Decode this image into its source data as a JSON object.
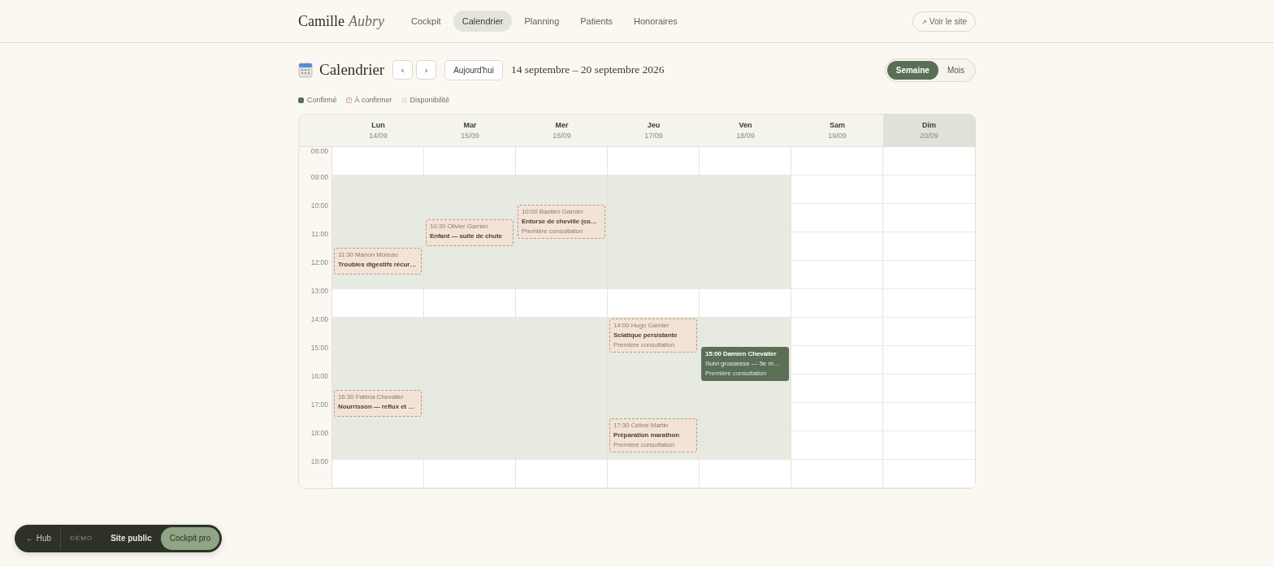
{
  "brand": {
    "first": "Camille",
    "last": "Aubry"
  },
  "nav": [
    {
      "label": "Cockpit",
      "selected": false
    },
    {
      "label": "Calendrier",
      "selected": true
    },
    {
      "label": "Planning",
      "selected": false
    },
    {
      "label": "Patients",
      "selected": false
    },
    {
      "label": "Honoraires",
      "selected": false
    }
  ],
  "site_link": {
    "icon": "↗",
    "label": "Voir le site"
  },
  "toolbar": {
    "title": "Calendrier",
    "prev": "‹",
    "next": "›",
    "today": "Aujourd'hui",
    "range": "14 septembre – 20 septembre 2026",
    "views": [
      {
        "label": "Semaine",
        "selected": true
      },
      {
        "label": "Mois",
        "selected": false
      }
    ]
  },
  "legend": [
    {
      "label": "Confirmé",
      "kind": "confirmed"
    },
    {
      "label": "À confirmer",
      "kind": "pending"
    },
    {
      "label": "Disponibilité",
      "kind": "available"
    }
  ],
  "hours": [
    "08:00",
    "09:00",
    "10:00",
    "11:00",
    "12:00",
    "13:00",
    "14:00",
    "15:00",
    "16:00",
    "17:00",
    "18:00",
    "19:00"
  ],
  "days": [
    {
      "name": "Lun",
      "date": "14/09",
      "selected": false,
      "slots": [
        {
          "available": false
        },
        {
          "available": true
        },
        {
          "available": true
        },
        {
          "available": true
        },
        {
          "available": true
        },
        {
          "available": false
        },
        {
          "available": true
        },
        {
          "available": true
        },
        {
          "available": true
        },
        {
          "available": true
        },
        {
          "available": true
        },
        {
          "available": false
        }
      ],
      "events": [
        {
          "time": "11:30",
          "name": "Manon Moreau",
          "title": "Troubles digestifs récur…",
          "kind": "pending"
        },
        {
          "time": "16:30",
          "name": "Fatima Chevalier",
          "title": "Nourrisson — reflux et …",
          "kind": "pending"
        }
      ]
    },
    {
      "name": "Mar",
      "date": "15/09",
      "selected": false,
      "slots": [
        {
          "available": false
        },
        {
          "available": true
        },
        {
          "available": true
        },
        {
          "available": true
        },
        {
          "available": true
        },
        {
          "available": false
        },
        {
          "available": true
        },
        {
          "available": true
        },
        {
          "available": true
        },
        {
          "available": true
        },
        {
          "available": true
        },
        {
          "available": false
        }
      ],
      "events": [
        {
          "time": "10:30",
          "name": "Olivier Garnier",
          "title": "Enfant — suite de chute",
          "kind": "pending"
        }
      ]
    },
    {
      "name": "Mer",
      "date": "16/09",
      "selected": false,
      "slots": [
        {
          "available": false
        },
        {
          "available": true
        },
        {
          "available": true
        },
        {
          "available": true
        },
        {
          "available": true
        },
        {
          "available": false
        },
        {
          "available": true
        },
        {
          "available": true
        },
        {
          "available": true
        },
        {
          "available": true
        },
        {
          "available": true
        },
        {
          "available": false
        }
      ],
      "events": [
        {
          "time": "10:00",
          "name": "Bastien Garnier",
          "title": "Entorse de cheville (co…",
          "note": "Première consultation",
          "kind": "pending"
        }
      ]
    },
    {
      "name": "Jeu",
      "date": "17/09",
      "selected": false,
      "slots": [
        {
          "available": false
        },
        {
          "available": true
        },
        {
          "available": true
        },
        {
          "available": true
        },
        {
          "available": true
        },
        {
          "available": false
        },
        {
          "available": true
        },
        {
          "available": true
        },
        {
          "available": true
        },
        {
          "available": true
        },
        {
          "available": true
        },
        {
          "available": false
        }
      ],
      "events": [
        {
          "time": "14:00",
          "name": "Hugo Garnier",
          "title": "Sciatique persistante",
          "note": "Première consultation",
          "kind": "pending"
        },
        {
          "time": "17:30",
          "name": "Céline Martin",
          "title": "Préparation marathon",
          "note": "Première consultation",
          "kind": "pending"
        }
      ]
    },
    {
      "name": "Ven",
      "date": "18/09",
      "selected": false,
      "slots": [
        {
          "available": false
        },
        {
          "available": true
        },
        {
          "available": true
        },
        {
          "available": true
        },
        {
          "available": true
        },
        {
          "available": false
        },
        {
          "available": true
        },
        {
          "available": true
        },
        {
          "available": true
        },
        {
          "available": true
        },
        {
          "available": true
        },
        {
          "available": false
        }
      ],
      "events": [
        {
          "time": "15:00",
          "name": "Damien Chevalier",
          "title": "Suivi grossesse — 5e m…",
          "note": "Première consultation",
          "kind": "confirmed"
        }
      ]
    },
    {
      "name": "Sam",
      "date": "19/09",
      "selected": false,
      "slots": [
        {
          "available": false
        },
        {
          "available": false
        },
        {
          "available": false
        },
        {
          "available": false
        },
        {
          "available": false
        },
        {
          "available": false
        },
        {
          "available": false
        },
        {
          "available": false
        },
        {
          "available": false
        },
        {
          "available": false
        },
        {
          "available": false
        },
        {
          "available": false
        }
      ]
    },
    {
      "name": "Dim",
      "date": "20/09",
      "selected": true,
      "slots": [
        {
          "available": false
        },
        {
          "available": false
        },
        {
          "available": false
        },
        {
          "available": false
        },
        {
          "available": false
        },
        {
          "available": false
        },
        {
          "available": false
        },
        {
          "available": false
        },
        {
          "available": false
        },
        {
          "available": false
        },
        {
          "available": false
        },
        {
          "available": false
        }
      ]
    }
  ],
  "demo_bar": [
    {
      "label": "← Hub",
      "kind": "link"
    },
    {
      "label": "DÉMO",
      "kind": "tag"
    },
    {
      "label": "Site public",
      "kind": "tab",
      "selected": false
    },
    {
      "label": "Cockpit pro",
      "kind": "tab",
      "selected": true
    }
  ]
}
